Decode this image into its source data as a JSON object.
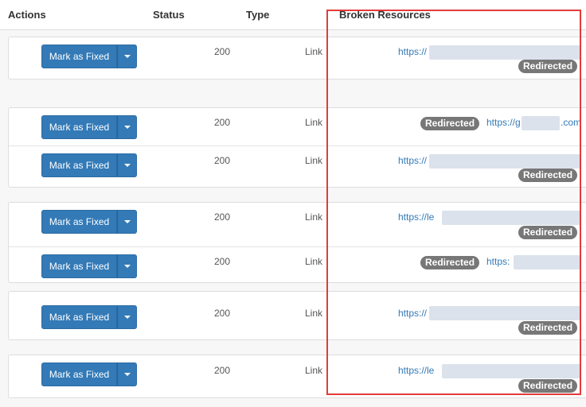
{
  "columns": {
    "actions": "Actions",
    "status": "Status",
    "type": "Type",
    "broken_resources": "Broken Resources"
  },
  "mark_fixed_label": "Mark as Fixed",
  "badge_label": "Redirected",
  "rows": [
    {
      "status": "200",
      "type": "Link",
      "url": "https://"
    },
    {
      "status": "200",
      "type": "Link",
      "url": "https://g"
    },
    {
      "status": "200",
      "type": "Link",
      "url": "https://"
    },
    {
      "status": "200",
      "type": "Link",
      "url": "https://le"
    },
    {
      "status": "200",
      "type": "Link",
      "url": "https:"
    },
    {
      "status": "200",
      "type": "Link",
      "url": "https://"
    },
    {
      "status": "200",
      "type": "Link",
      "url": "https://le"
    }
  ],
  "row2_url_tail": ".com",
  "colors": {
    "button": "#337ab7",
    "badge": "#777777",
    "link": "#337ab7",
    "highlight_box": "#e23b3b"
  },
  "icons": [
    "caret-down-icon"
  ]
}
